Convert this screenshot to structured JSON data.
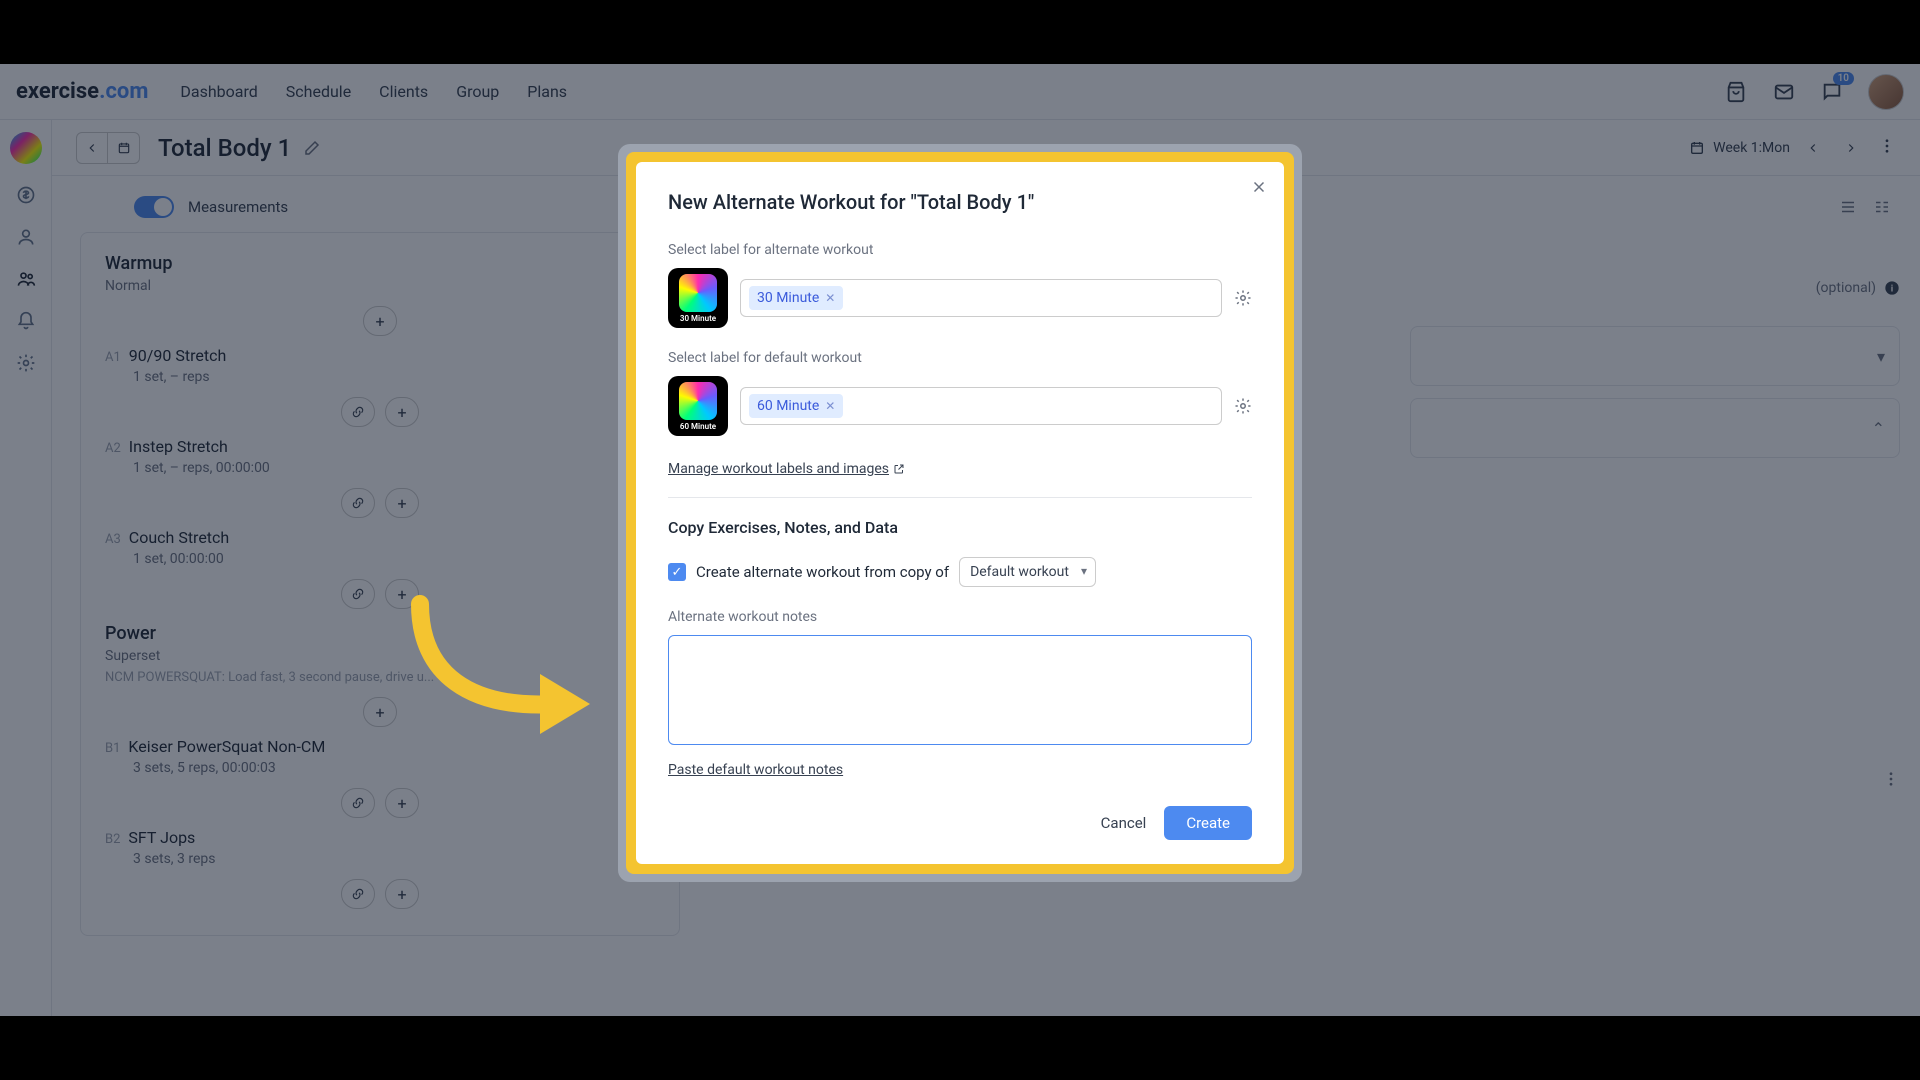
{
  "brand": {
    "name_a": "exercise",
    "name_b": ".com"
  },
  "topnav": [
    "Dashboard",
    "Schedule",
    "Clients",
    "Group",
    "Plans"
  ],
  "notifications_count": "10",
  "page": {
    "title": "Total Body 1",
    "week_label": "Week 1:Mon"
  },
  "measurements_label": "Measurements",
  "workout": {
    "sections": [
      {
        "title": "Warmup",
        "subtitle": "Normal",
        "note": "",
        "exercises": [
          {
            "idx": "A1",
            "name": "90/90 Stretch",
            "meta": "1 set, – reps"
          },
          {
            "idx": "A2",
            "name": "Instep Stretch",
            "meta": "1 set, – reps, 00:00:00"
          },
          {
            "idx": "A3",
            "name": "Couch Stretch",
            "meta": "1 set, 00:00:00"
          }
        ]
      },
      {
        "title": "Power",
        "subtitle": "Superset",
        "note": "NCM POWERSQUAT: Load fast, 3 second pause, drive u...",
        "exercises": [
          {
            "idx": "B1",
            "name": "Keiser PowerSquat Non-CM",
            "meta": "3 sets, 5 reps, 00:00:03"
          },
          {
            "idx": "B2",
            "name": "SFT Jops",
            "meta": "3 sets, 3 reps"
          }
        ]
      }
    ]
  },
  "right_ghost_optional": "(optional)",
  "modal": {
    "title": "New Alternate Workout for \"Total Body 1\"",
    "alt_label_heading": "Select label for alternate workout",
    "alt_chip": "30 Minute",
    "alt_thumb_text": "30 Minute",
    "default_label_heading": "Select label for default workout",
    "default_chip": "60 Minute",
    "default_thumb_text": "60 Minute",
    "manage_link": "Manage workout labels and images",
    "copy_heading": "Copy Exercises, Notes, and Data",
    "checkbox_label": "Create alternate workout from copy of",
    "select_value": "Default workout",
    "notes_label": "Alternate workout notes",
    "notes_value": "",
    "paste_link": "Paste default workout notes",
    "cancel": "Cancel",
    "create": "Create"
  }
}
